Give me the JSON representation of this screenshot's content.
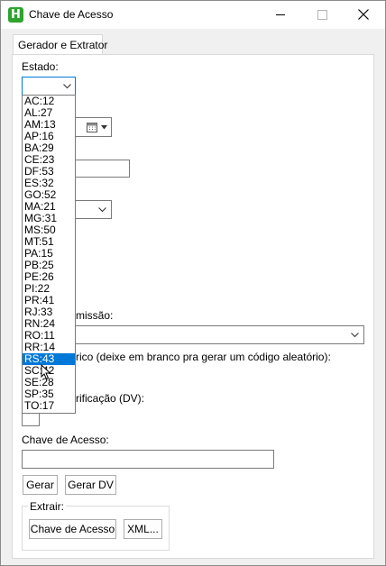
{
  "window": {
    "title": "Chave de Acesso",
    "app_icon_letter": "H"
  },
  "tabs": [
    {
      "label": "Gerador e Extrator",
      "selected": true
    }
  ],
  "form": {
    "estado_label": "Estado:",
    "estado_value": "",
    "emissao_label_visible": "missão:",
    "numerico_label_visible": "rico (deixe em branco pra gerar um código aleatório):",
    "dv_label_visible": "rificação (DV):",
    "chave_label": "Chave de Acesso:",
    "chave_value": ""
  },
  "buttons": {
    "gerar": "Gerar",
    "gerar_dv": "Gerar DV"
  },
  "extrair": {
    "title": "Extrair:",
    "chave_button": "Chave de Acesso",
    "xml_button": "XML..."
  },
  "estado_options": [
    "AC:12",
    "AL:27",
    "AM:13",
    "AP:16",
    "BA:29",
    "CE:23",
    "DF:53",
    "ES:32",
    "GO:52",
    "MA:21",
    "MG:31",
    "MS:50",
    "MT:51",
    "PA:15",
    "PB:25",
    "PE:26",
    "PI:22",
    "PR:41",
    "RJ:33",
    "RN:24",
    "RO:11",
    "RR:14",
    "RS:43",
    "SC:42",
    "SE:28",
    "SP:35",
    "TO:17"
  ],
  "highlighted_option": "RS:43",
  "colors": {
    "selection": "#0078d7",
    "app_icon": "#2fa32f",
    "panel_bg": "#ffffff",
    "window_bg": "#f0f0f0"
  }
}
